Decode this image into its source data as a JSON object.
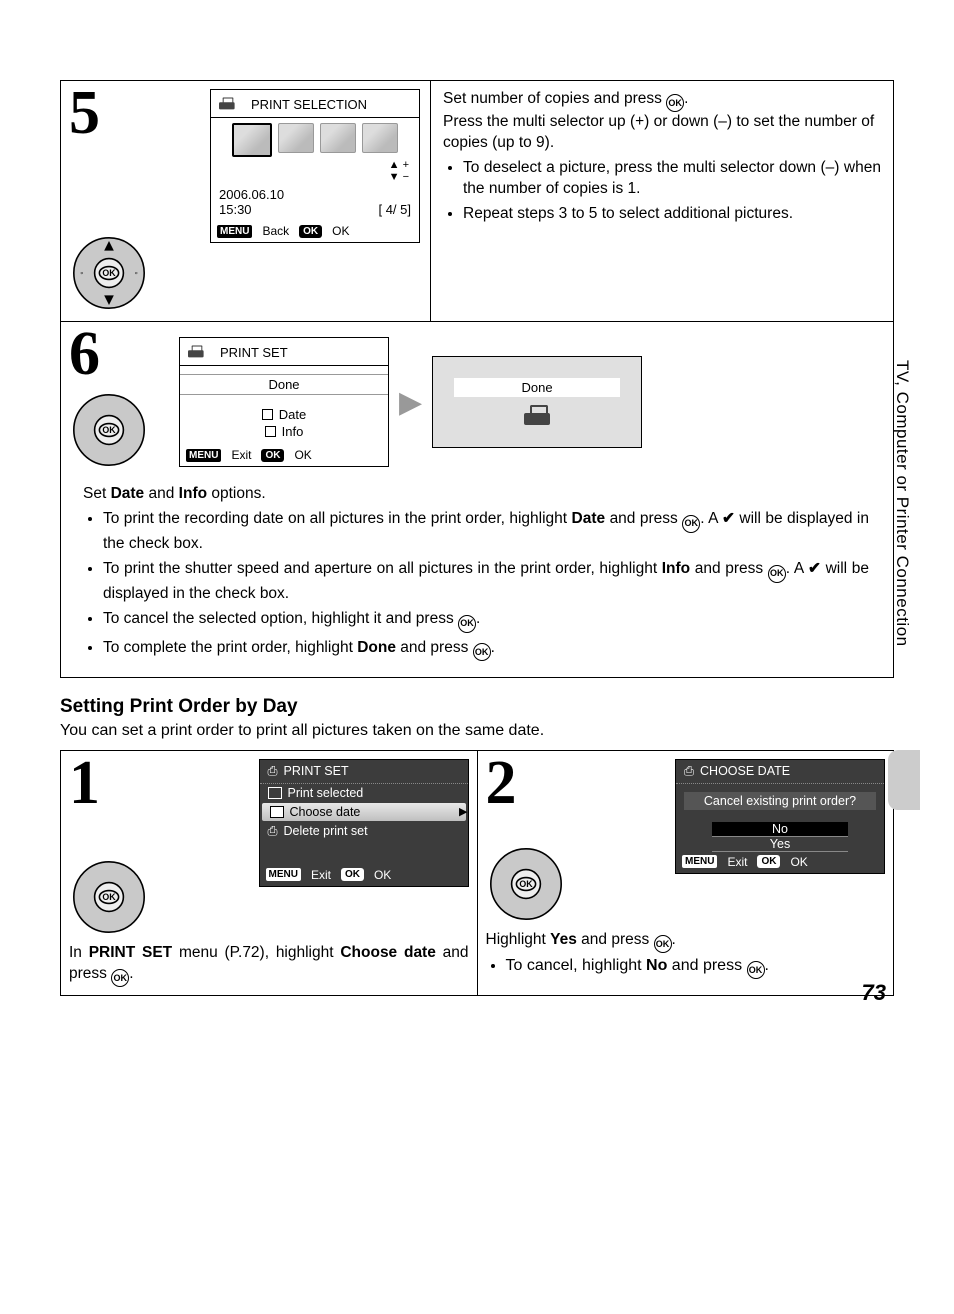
{
  "sideTab": "TV, Computer or Printer Connection",
  "pageNumber": "73",
  "step5": {
    "num": "5",
    "lcdTitle": "PRINT SELECTION",
    "date": "2006.06.10",
    "time": "15:30",
    "counter": "[      4/      5]",
    "footBack": "Back",
    "footOk": "OK",
    "heading": "Set number of copies and press ",
    "headingAfter": ".",
    "sub": "Press the multi selector up (+) or down (–) to set the number of copies (up to 9).",
    "b1": "To deselect a picture, press the multi selector down (–) when the number of copies is 1.",
    "b2": "Repeat steps 3 to 5 to select additional pictures."
  },
  "step6": {
    "num": "6",
    "lcdTitle": "PRINT SET",
    "done": "Done",
    "date": "Date",
    "info": "Info",
    "footExit": "Exit",
    "footOk": "OK",
    "previewDone": "Done",
    "intro_a": "Set ",
    "intro_b": "Date",
    "intro_c": " and ",
    "intro_d": "Info",
    "intro_e": " options.",
    "b1a": "To print the recording date on all pictures in the print order, highlight ",
    "b1b": "Date",
    "b1c": " and press ",
    "b1d": ". A ",
    "b1e": " will be displayed in the check box.",
    "b2a": "To print the shutter speed and aperture on all pictures in the print order, highlight ",
    "b2b": "Info",
    "b2c": " and press ",
    "b2d": ". A ",
    "b2e": " will be displayed in the check box.",
    "b3a": "To cancel the selected option, highlight it and press ",
    "b3b": ".",
    "b4a": "To complete the print order, highlight ",
    "b4b": "Done",
    "b4c": " and press ",
    "b4d": "."
  },
  "section2": {
    "heading": "Setting Print Order by Day",
    "intro": "You can set a print order to print all pictures taken on the same date."
  },
  "step1b": {
    "num": "1",
    "lcdTitle": "PRINT SET",
    "m1": "Print selected",
    "m2": "Choose date",
    "m3": "Delete print set",
    "footExit": "Exit",
    "footOk": "OK",
    "instr_a": "In ",
    "instr_b": "PRINT SET",
    "instr_c": " menu (P.72), highlight ",
    "instr_d": "Choose date",
    "instr_e": " and press ",
    "instr_f": "."
  },
  "step2b": {
    "num": "2",
    "lcdTitle": "CHOOSE DATE",
    "prompt": "Cancel existing print order?",
    "no": "No",
    "yes": "Yes",
    "footExit": "Exit",
    "footOk": "OK",
    "instr_a": "Highlight ",
    "instr_b": "Yes",
    "instr_c": " and press ",
    "instr_d": ".",
    "b1a": "To cancel, highlight ",
    "b1b": "No",
    "b1c": " and press ",
    "b1d": "."
  }
}
